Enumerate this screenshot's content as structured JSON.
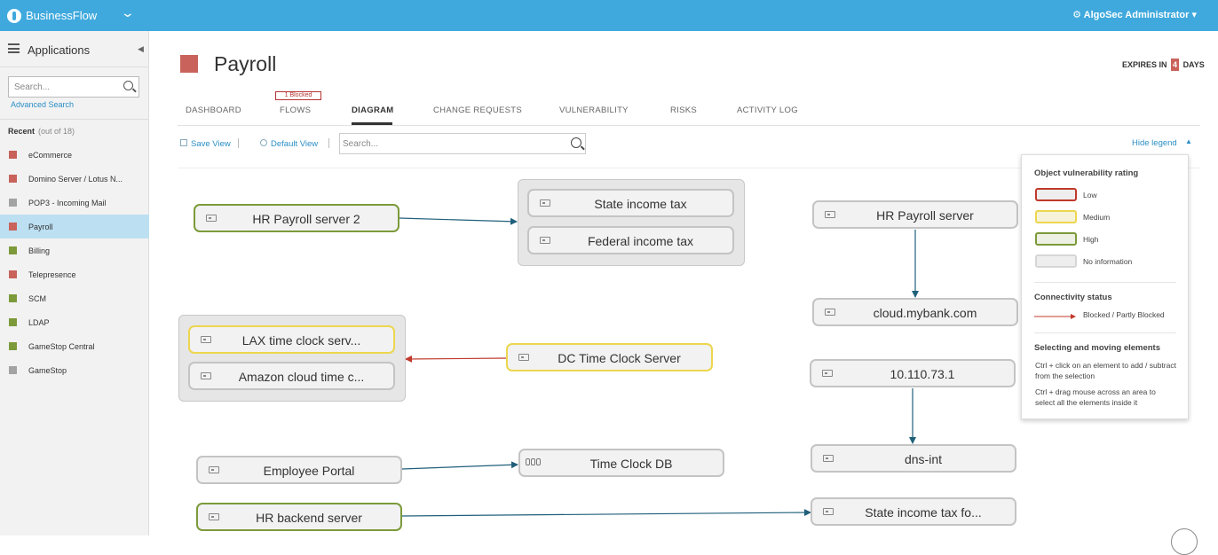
{
  "colors": {
    "brand": "#3fa9dd",
    "low": "#c9625b",
    "medium": "#ecd64f",
    "high": "#7c9a3a",
    "none": "#cccccc",
    "blocked": "#c0392b",
    "link": "#2b8fc6",
    "edge": "#1f5f7a"
  },
  "topbar": {
    "app_name": "BusinessFlow",
    "app_menu_icon": "chevron-down-icon",
    "admin": "⚙ AlgoSec Administrator ▾"
  },
  "sidebar": {
    "title": "Applications",
    "search_placeholder": "Search...",
    "advanced_search": "Advanced Search",
    "recent_label": "Recent",
    "recent_count": "(out of 18)",
    "items": [
      {
        "label": "eCommerce",
        "rating": "low"
      },
      {
        "label": "Domino Server / Lotus N...",
        "rating": "low"
      },
      {
        "label": "POP3 - Incoming Mail",
        "rating": "none"
      },
      {
        "label": "Payroll",
        "rating": "low",
        "active": true
      },
      {
        "label": "Billing",
        "rating": "high"
      },
      {
        "label": "Telepresence",
        "rating": "low"
      },
      {
        "label": "SCM",
        "rating": "high"
      },
      {
        "label": "LDAP",
        "rating": "high"
      },
      {
        "label": "GameStop Central",
        "rating": "high"
      },
      {
        "label": "GameStop",
        "rating": "none"
      }
    ]
  },
  "page": {
    "title": "Payroll",
    "expires_prefix": "EXPIRES IN",
    "expires_days": "4",
    "expires_suffix": "DAYS"
  },
  "tabs": {
    "dashboard": "DASHBOARD",
    "flows": "FLOWS",
    "flows_badge": "1 Blocked",
    "diagram": "DIAGRAM",
    "change_requests": "CHANGE REQUESTS",
    "vulnerability": "VULNERABILITY",
    "risks": "RISKS",
    "activity_log": "ACTIVITY LOG",
    "active": "DIAGRAM"
  },
  "toolbar": {
    "save_view": "Save View",
    "default_view": "Default View",
    "search_placeholder": "Search...",
    "hide_legend": "Hide legend"
  },
  "diagram": {
    "nodes": {
      "hr_payroll_server_2": "HR Payroll server 2",
      "state_income_tax": "State income tax",
      "federal_income_tax": "Federal income tax",
      "hr_payroll_server": "HR Payroll server",
      "cloud_mybank": "cloud.mybank.com",
      "lax_time_clock": "LAX time clock serv...",
      "amazon_cloud_time": "Amazon cloud time c...",
      "dc_time_clock": "DC Time Clock Server",
      "ip_10_110_73_1": "10.110.73.1",
      "employee_portal": "Employee Portal",
      "time_clock_db": "Time Clock DB",
      "dns_int": "dns-int",
      "hr_backend_server": "HR backend server",
      "state_income_tax_fo": "State income tax fo..."
    }
  },
  "legend": {
    "rating_title": "Object vulnerability rating",
    "low": "Low",
    "medium": "Medium",
    "high": "High",
    "no_info": "No information",
    "connectivity_title": "Connectivity status",
    "blocked": "Blocked / Partly Blocked",
    "selecting_title": "Selecting and moving elements",
    "tip1": "Ctrl + click on an element to add / subtract from the selection",
    "tip2": "Ctrl + drag mouse across an area to select all the elements inside it"
  }
}
